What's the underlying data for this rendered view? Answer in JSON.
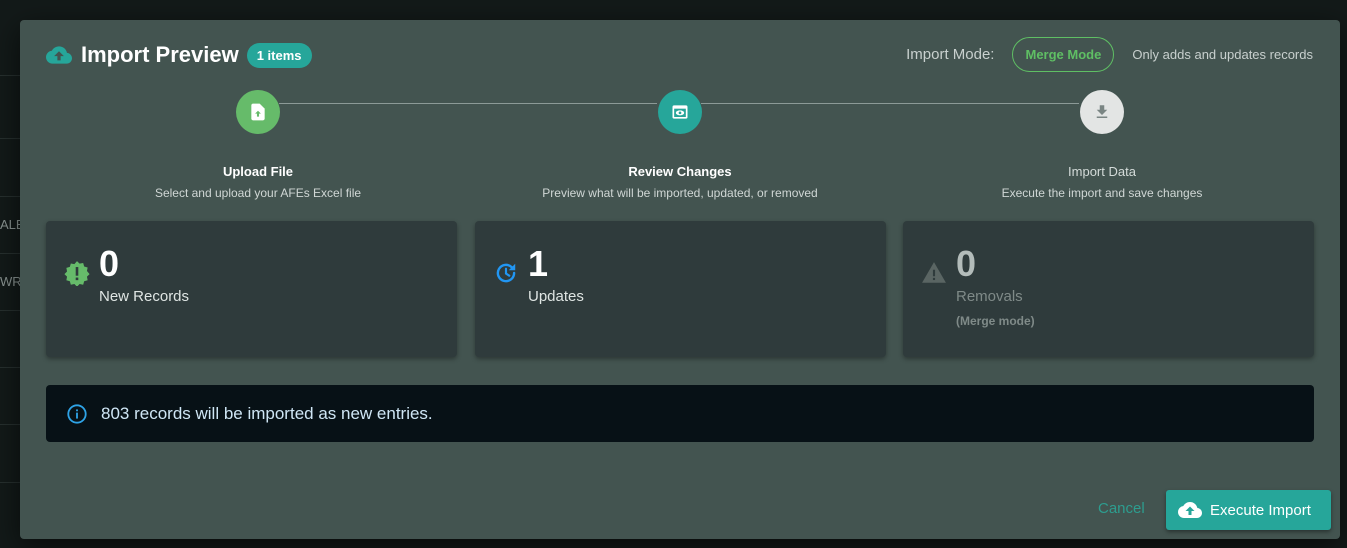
{
  "background": {
    "fragments": [
      "ALE",
      "WRT"
    ]
  },
  "dialog": {
    "title": "Import Preview",
    "count_badge": "1 items",
    "import_mode_label": "Import Mode:",
    "import_mode_value": "Merge Mode",
    "import_mode_description": "Only adds and updates records",
    "steps": [
      {
        "title": "Upload File",
        "description": "Select and upload your AFEs Excel file",
        "icon": "upload-file-icon",
        "state": "completed"
      },
      {
        "title": "Review Changes",
        "description": "Preview what will be imported, updated, or removed",
        "icon": "preview-icon",
        "state": "active"
      },
      {
        "title": "Import Data",
        "description": "Execute the import and save changes",
        "icon": "download-icon",
        "state": "pending"
      }
    ],
    "cards": [
      {
        "value": "0",
        "label": "New Records",
        "sublabel": "",
        "icon": "new-badge-icon"
      },
      {
        "value": "1",
        "label": "Updates",
        "sublabel": "",
        "icon": "update-icon"
      },
      {
        "value": "0",
        "label": "Removals",
        "sublabel": "(Merge mode)",
        "icon": "warning-icon"
      }
    ],
    "info_message": "803 records will be imported as new entries.",
    "cancel_label": "Cancel",
    "execute_label": "Execute Import"
  },
  "colors": {
    "accent": "#26a69a",
    "success": "#5fbf64",
    "info": "#2196f3",
    "dialog_bg": "#435450",
    "card_bg": "#2f3b3c"
  }
}
